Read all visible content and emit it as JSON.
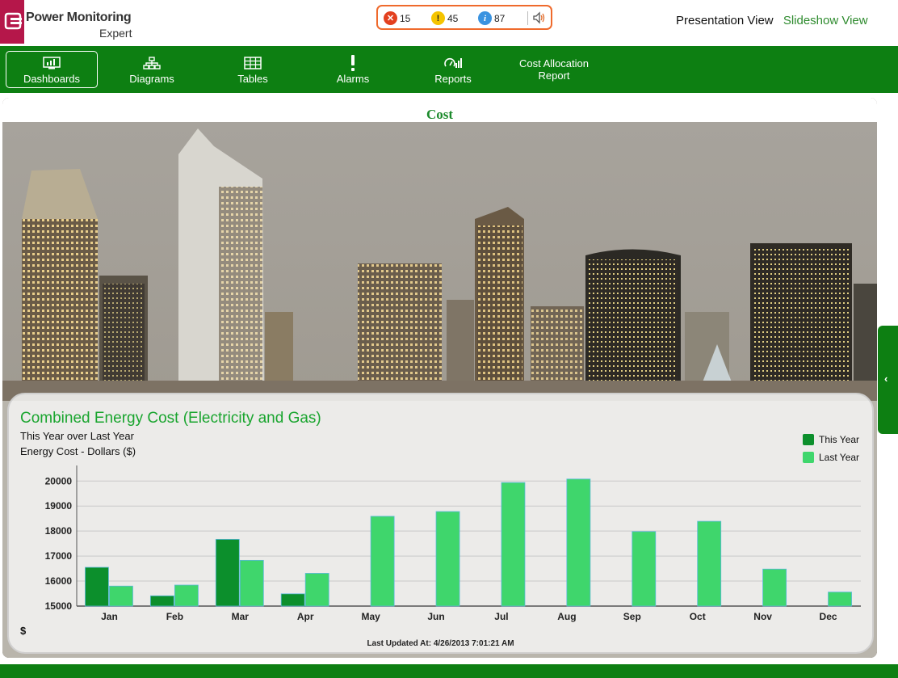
{
  "app": {
    "logo_line1": "Power Monitoring",
    "logo_line2": "Expert"
  },
  "alarms": {
    "errors": "15",
    "warnings": "45",
    "info": "87",
    "error_icon": "error-circle-icon",
    "warning_icon": "warning-circle-icon",
    "info_icon": "info-circle-icon",
    "sound_icon": "speaker-icon"
  },
  "views": {
    "presentation": "Presentation View",
    "slideshow": "Slideshow View"
  },
  "nav": {
    "items": [
      {
        "label": "Dashboards",
        "icon": "dashboard-icon",
        "active": true
      },
      {
        "label": "Diagrams",
        "icon": "diagram-icon",
        "active": false
      },
      {
        "label": "Tables",
        "icon": "table-icon",
        "active": false
      },
      {
        "label": "Alarms",
        "icon": "alarm-icon",
        "active": false
      },
      {
        "label": "Reports",
        "icon": "reports-icon",
        "active": false
      },
      {
        "label": "Cost Allocation\nReport",
        "icon": "",
        "active": false
      }
    ]
  },
  "panel": {
    "title": "Cost"
  },
  "chart_data": {
    "type": "bar",
    "title": "Combined Energy Cost (Electricity and Gas)",
    "subtitle1": "This Year over Last Year",
    "subtitle2": "Energy Cost - Dollars ($)",
    "ylabel": "$",
    "ylim": [
      15000,
      20300
    ],
    "yticks": [
      "20000",
      "19000",
      "18000",
      "17000",
      "16000",
      "15000"
    ],
    "categories": [
      "Jan",
      "Feb",
      "Mar",
      "Apr",
      "May",
      "Jun",
      "Jul",
      "Aug",
      "Sep",
      "Oct",
      "Nov",
      "Dec"
    ],
    "series": [
      {
        "name": "This Year",
        "color": "#0c8f2c",
        "values": [
          16550,
          15410,
          17670,
          15490,
          null,
          null,
          null,
          null,
          null,
          null,
          null,
          null
        ]
      },
      {
        "name": "Last Year",
        "color": "#3fd66c",
        "values": [
          15800,
          15840,
          16830,
          16310,
          18590,
          18780,
          19940,
          20080,
          17980,
          18390,
          16480,
          15560
        ]
      }
    ],
    "legend_position": "top-right",
    "grid": true,
    "updated": "Last Updated At: 4/26/2013 7:01:21 AM"
  }
}
